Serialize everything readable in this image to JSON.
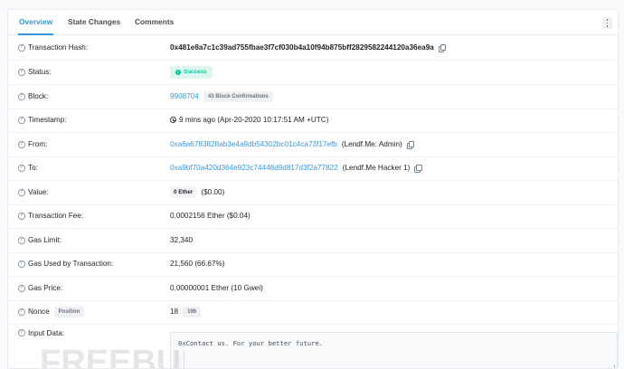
{
  "tabs": [
    {
      "label": "Overview",
      "active": true
    },
    {
      "label": "State Changes",
      "active": false
    },
    {
      "label": "Comments",
      "active": false
    }
  ],
  "rows": {
    "hash": {
      "label": "Transaction Hash:",
      "value": "0x481e8a7c1c39ad755fbae3f7cf030b4a10f94b875bff2829582244120a36ea9a"
    },
    "status": {
      "label": "Status:",
      "value": "Success"
    },
    "block": {
      "label": "Block:",
      "value": "9908704",
      "confirmations": "43 Block Confirmations"
    },
    "timestamp": {
      "label": "Timestamp:",
      "value": "9 mins ago (Apr-20-2020 10:17:51 AM +UTC)"
    },
    "from": {
      "label": "From:",
      "address": "0xa6a6783828ab3e4a9db54302bc01c4ca73f17efb",
      "name": "(Lendf.Me: Admin)"
    },
    "to": {
      "label": "To:",
      "address": "0xa9bf70a420d364e923c74448d9d817d3f2a77822",
      "name": "(Lendf.Me Hacker 1)"
    },
    "value": {
      "label": "Value:",
      "amount": "0 Ether",
      "usd": "($0.00)"
    },
    "fee": {
      "label": "Transaction Fee:",
      "value": "0.0002156 Ether ($0.04)"
    },
    "gas_limit": {
      "label": "Gas Limit:",
      "value": "32,340"
    },
    "gas_used": {
      "label": "Gas Used by Transaction:",
      "value": "21,560 (66.67%)"
    },
    "gas_price": {
      "label": "Gas Price:",
      "value": "0.00000001 Ether (10 Gwei)"
    },
    "nonce": {
      "label": "Nonce",
      "badge": "Position",
      "value": "18",
      "position": "196"
    },
    "input": {
      "label": "Input Data:",
      "value": "0xContact us. For your better future."
    }
  },
  "icons": {
    "help": "question-circle-icon",
    "copy": "copy-icon",
    "clock": "clock-icon",
    "success": "check-circle-icon",
    "more": "vertical-ellipsis-icon"
  },
  "watermark": {
    "text": "FREEBUF"
  },
  "colors": {
    "link": "#3498db",
    "success": "#00c9a7",
    "success_bg": "#def6ee",
    "text": "#1e2022"
  }
}
